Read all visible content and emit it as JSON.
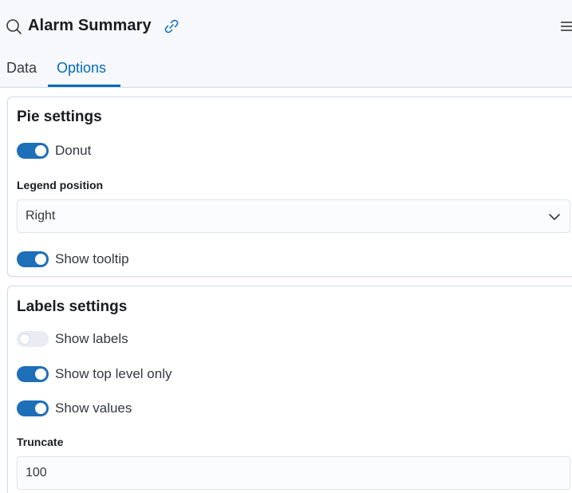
{
  "header": {
    "title": "Alarm Summary",
    "icons": {
      "search": "search-icon",
      "link": "link-icon",
      "menu": "menu-icon"
    }
  },
  "tabs": [
    {
      "label": "Data",
      "selected": false
    },
    {
      "label": "Options",
      "selected": true
    }
  ],
  "pie_settings": {
    "title": "Pie settings",
    "donut": {
      "label": "Donut",
      "checked": true
    },
    "legend_position": {
      "label": "Legend position",
      "value": "Right"
    },
    "show_tooltip": {
      "label": "Show tooltip",
      "checked": true
    }
  },
  "labels_settings": {
    "title": "Labels settings",
    "show_labels": {
      "label": "Show labels",
      "checked": false
    },
    "show_top_level_only": {
      "label": "Show top level only",
      "checked": true
    },
    "show_values": {
      "label": "Show values",
      "checked": true
    },
    "truncate": {
      "label": "Truncate",
      "value": "100"
    }
  },
  "colors": {
    "accent": "#006bb8",
    "switch_on": "#1d6fb8",
    "switch_off": "#e9edf3",
    "header_bg": "#f7f8fc",
    "border": "#d3dae6"
  }
}
